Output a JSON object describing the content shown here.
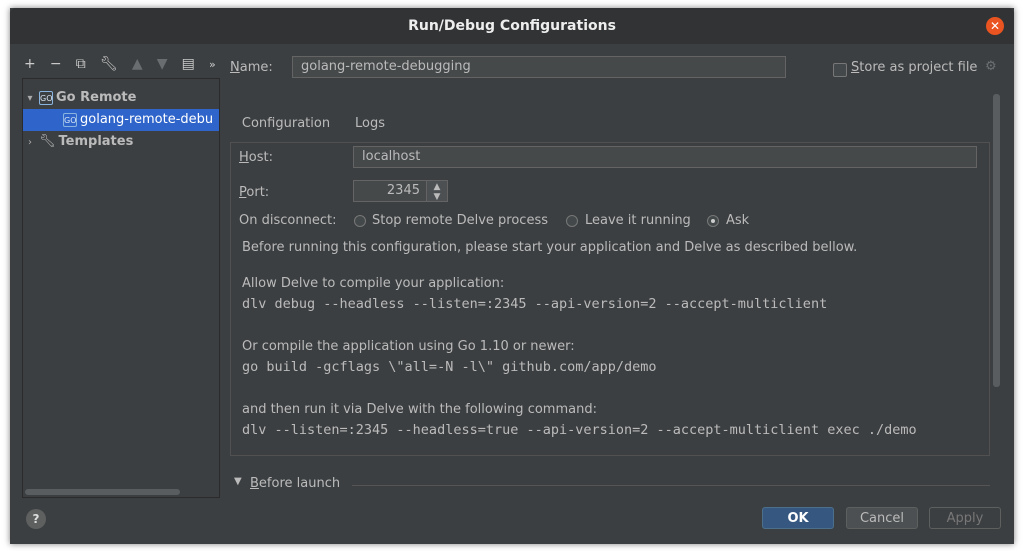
{
  "window": {
    "title": "Run/Debug Configurations"
  },
  "toolbar": {
    "icons": [
      "add-icon",
      "remove-icon",
      "copy-icon",
      "wrench-icon",
      "move-up-icon",
      "move-down-icon",
      "folder-add-icon",
      "more-icon"
    ]
  },
  "tree": {
    "items": [
      {
        "label": "Go Remote",
        "expanded": true
      },
      {
        "label": "golang-remote-debu",
        "selected": true
      },
      {
        "label": "Templates",
        "expanded": false
      }
    ]
  },
  "name_row": {
    "label": "Name:",
    "label_mnemonic": "N",
    "label_rest": "ame:",
    "value": "golang-remote-debugging",
    "store_label": "Store as project file",
    "store_mnemonic": "S",
    "store_rest": "tore as project file",
    "store_checked": false
  },
  "tabs": [
    {
      "label": "Configuration",
      "active": true
    },
    {
      "label": "Logs",
      "active": false
    }
  ],
  "config": {
    "host_label": "Host:",
    "host_mnemonic": "H",
    "host_rest": "ost:",
    "host_value": "localhost",
    "port_label": "Port:",
    "port_mnemonic": "P",
    "port_rest": "ort:",
    "port_value": "2345",
    "on_disconnect_label": "On disconnect:",
    "options": [
      {
        "label": "Stop remote Delve process",
        "selected": false
      },
      {
        "label": "Leave it running",
        "selected": false
      },
      {
        "label": "Ask",
        "selected": true
      }
    ],
    "intro": "Before running this configuration, please start your application and Delve as described bellow.",
    "step1_text": "Allow Delve to compile your application:",
    "step1_cmd": "dlv debug --headless --listen=:2345 --api-version=2 --accept-multiclient",
    "step2_text": "Or compile the application using Go 1.10 or newer:",
    "step2_cmd": "go build -gcflags \\\"all=-N -l\\\" github.com/app/demo",
    "step3_text": "and then run it via Delve with the following command:",
    "step3_cmd": "dlv --listen=:2345 --headless=true --api-version=2 --accept-multiclient exec ./demo"
  },
  "before_launch": {
    "label": "Before launch",
    "mnemonic": "B",
    "rest": "efore launch"
  },
  "buttons": {
    "ok": "OK",
    "cancel": "Cancel",
    "apply": "Apply"
  },
  "colors": {
    "background": "#3c3f41",
    "selection": "#2f65ca",
    "ok_button": "#365880",
    "close_button": "#e95420"
  }
}
